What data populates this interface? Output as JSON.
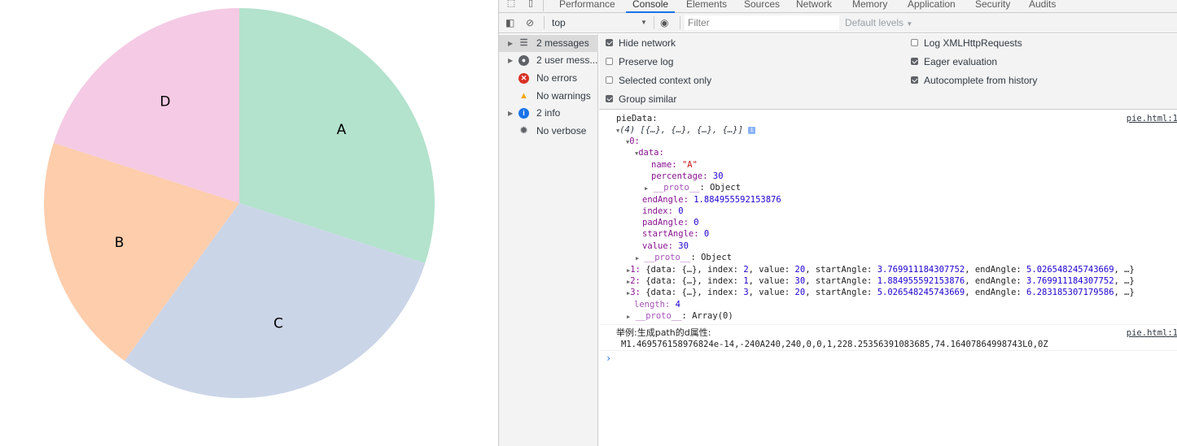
{
  "chart_data": {
    "type": "pie",
    "categories": [
      "A",
      "B",
      "C",
      "D"
    ],
    "values": [
      30,
      20,
      30,
      20
    ],
    "order": [
      0,
      2,
      1,
      3
    ],
    "colors": [
      "#b3e2cd",
      "#fdcdac",
      "#cbd5e8",
      "#f4cae4"
    ]
  },
  "devtools": {
    "tabs": [
      "Performance",
      "Console",
      "Elements",
      "Sources",
      "Network",
      "Memory",
      "Application",
      "Security",
      "Audits"
    ],
    "active_tab": "Console",
    "toolbar": {
      "context": "top",
      "filter_placeholder": "Filter",
      "levels": "Default levels"
    },
    "sidebar": [
      {
        "label": "2 messages",
        "icon": "list-icon",
        "has_arrow": true,
        "selected": true
      },
      {
        "label": "2 user mess...",
        "icon": "user-icon",
        "has_arrow": true,
        "selected": false
      },
      {
        "label": "No errors",
        "icon": "error-icon",
        "has_arrow": false,
        "selected": false
      },
      {
        "label": "No warnings",
        "icon": "warning-icon",
        "has_arrow": false,
        "selected": false
      },
      {
        "label": "2 info",
        "icon": "info-icon",
        "has_arrow": true,
        "selected": false
      },
      {
        "label": "No verbose",
        "icon": "bug-icon",
        "has_arrow": false,
        "selected": false
      }
    ],
    "settings": {
      "left": [
        {
          "label": "Hide network",
          "checked": true
        },
        {
          "label": "Preserve log",
          "checked": false
        },
        {
          "label": "Selected context only",
          "checked": false
        },
        {
          "label": "Group similar",
          "checked": true
        }
      ],
      "right": [
        {
          "label": "Log XMLHttpRequests",
          "checked": false
        },
        {
          "label": "Eager evaluation",
          "checked": true
        },
        {
          "label": "Autocomplete from history",
          "checked": true
        }
      ]
    },
    "console": {
      "msg1_label": "pieData:",
      "msg1_source": "pie.html:1",
      "array_summary": "(4) [{…}, {…}, {…}, {…}]",
      "info_badge": "i",
      "item0_key": "0:",
      "data_key": "data:",
      "name_key": "name:",
      "name_val": "\"A\"",
      "percentage_key": "percentage:",
      "percentage_val": "30",
      "proto_key": "__proto__",
      "proto_obj": ": Object",
      "endAngle_key": "endAngle:",
      "endAngle_val": "1.884955592153876",
      "index_key": "index:",
      "index_val": "0",
      "padAngle_key": "padAngle:",
      "padAngle_val": "0",
      "startAngle_key": "startAngle:",
      "startAngle_val": "0",
      "value_key": "value:",
      "value_val": "30",
      "items": [
        {
          "idx": "1:",
          "index": "2",
          "value": "20",
          "startAngle": "3.769911184307752",
          "endAngle": "5.026548245743669"
        },
        {
          "idx": "2:",
          "index": "1",
          "value": "30",
          "startAngle": "1.884955592153876",
          "endAngle": "3.769911184307752"
        },
        {
          "idx": "3:",
          "index": "3",
          "value": "20",
          "startAngle": "5.026548245743669",
          "endAngle": "6.283185307179586"
        }
      ],
      "length_key": "length:",
      "length_val": "4",
      "array_proto": ": Array(0)",
      "msg2_label": "举例:生成path的d属性:",
      "msg2_source": "pie.html:1",
      "msg2_value": "M1.469576158976824e-14,-240A240,240,0,0,1,228.25356391083685,74.16407864998743L0,0Z",
      "prompt": "›"
    }
  }
}
